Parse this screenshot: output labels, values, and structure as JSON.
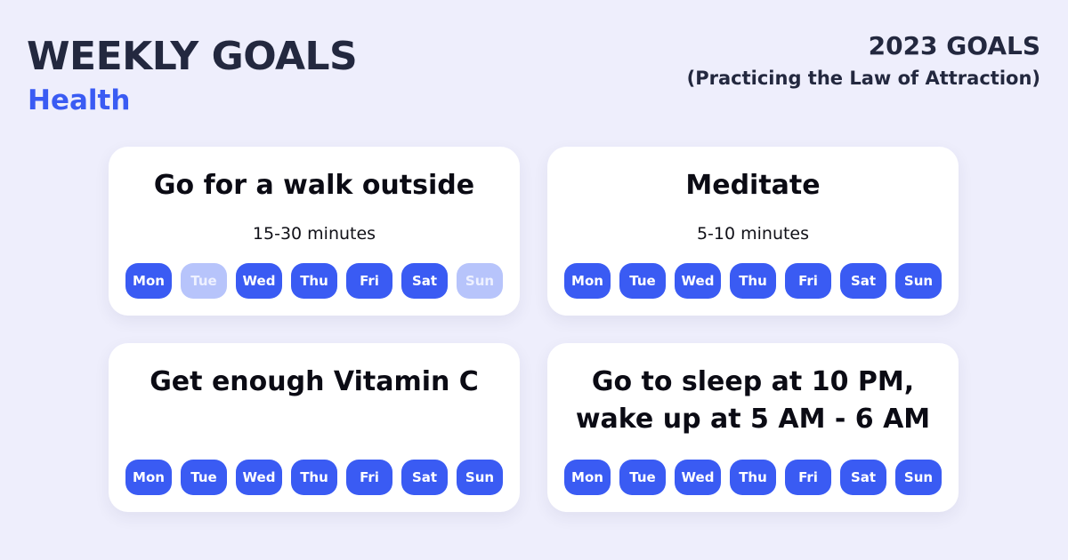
{
  "header": {
    "title": "WEEKLY GOALS",
    "subtitle": "Health",
    "year_title": "2023 GOALS",
    "year_subtitle": "(Practicing the Law of Attraction)"
  },
  "colors": {
    "background": "#eeeefc",
    "accent": "#3a5bf3",
    "day_inactive": "#b7c4fb",
    "heading": "#23283f"
  },
  "goals": [
    {
      "title_lines": [
        "Go for a walk outside"
      ],
      "duration": "15-30 minutes",
      "days": [
        {
          "label": "Mon",
          "active": true
        },
        {
          "label": "Tue",
          "active": false
        },
        {
          "label": "Wed",
          "active": true
        },
        {
          "label": "Thu",
          "active": true
        },
        {
          "label": "Fri",
          "active": true
        },
        {
          "label": "Sat",
          "active": true
        },
        {
          "label": "Sun",
          "active": false
        }
      ]
    },
    {
      "title_lines": [
        "Meditate"
      ],
      "duration": "5-10 minutes",
      "days": [
        {
          "label": "Mon",
          "active": true
        },
        {
          "label": "Tue",
          "active": true
        },
        {
          "label": "Wed",
          "active": true
        },
        {
          "label": "Thu",
          "active": true
        },
        {
          "label": "Fri",
          "active": true
        },
        {
          "label": "Sat",
          "active": true
        },
        {
          "label": "Sun",
          "active": true
        }
      ]
    },
    {
      "title_lines": [
        "Get enough Vitamin C"
      ],
      "duration": "",
      "days": [
        {
          "label": "Mon",
          "active": true
        },
        {
          "label": "Tue",
          "active": true
        },
        {
          "label": "Wed",
          "active": true
        },
        {
          "label": "Thu",
          "active": true
        },
        {
          "label": "Fri",
          "active": true
        },
        {
          "label": "Sat",
          "active": true
        },
        {
          "label": "Sun",
          "active": true
        }
      ]
    },
    {
      "title_lines": [
        "Go to sleep at 10 PM,",
        "wake up at 5 AM - 6 AM"
      ],
      "duration": "",
      "days": [
        {
          "label": "Mon",
          "active": true
        },
        {
          "label": "Tue",
          "active": true
        },
        {
          "label": "Wed",
          "active": true
        },
        {
          "label": "Thu",
          "active": true
        },
        {
          "label": "Fri",
          "active": true
        },
        {
          "label": "Sat",
          "active": true
        },
        {
          "label": "Sun",
          "active": true
        }
      ]
    }
  ]
}
